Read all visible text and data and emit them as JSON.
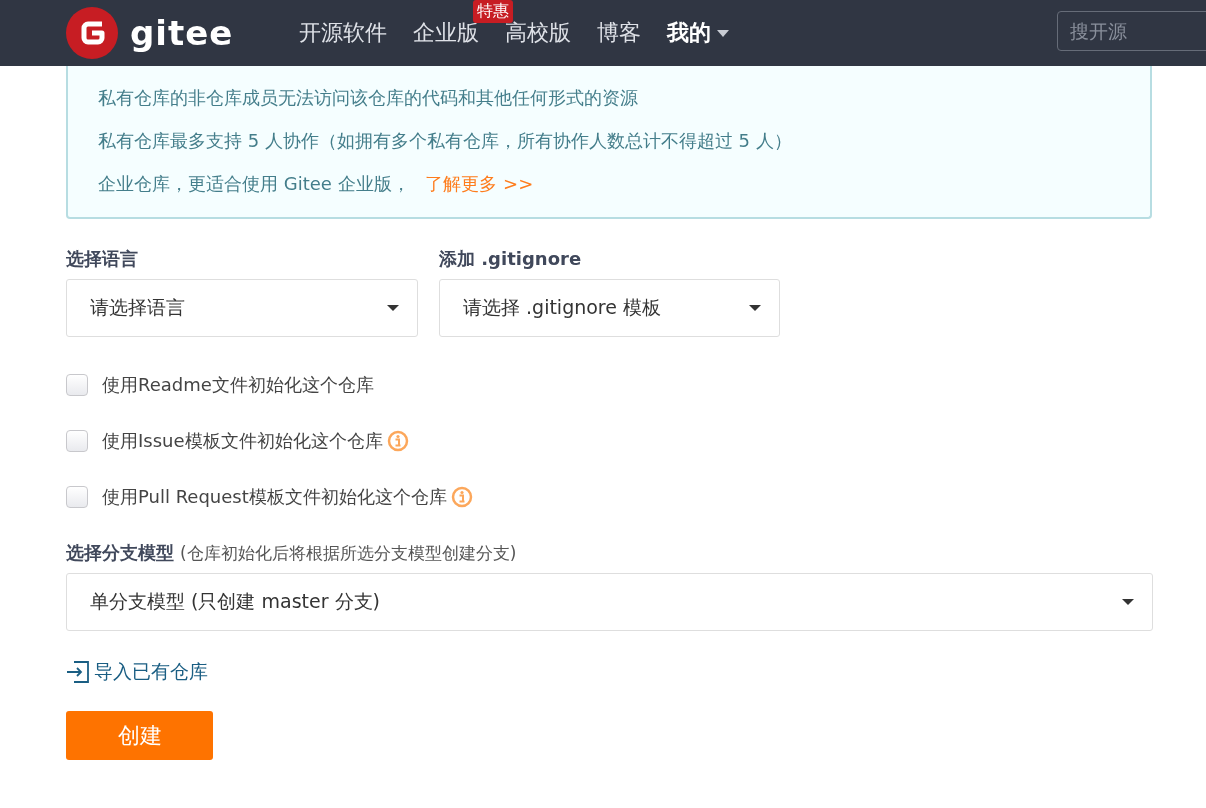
{
  "nav": {
    "logo_text": "gitee",
    "items": [
      {
        "label": "开源软件",
        "dropdown": false,
        "current": false
      },
      {
        "label": "企业版",
        "badge": "特惠",
        "dropdown": false,
        "current": false
      },
      {
        "label": "高校版",
        "dropdown": false,
        "current": false
      },
      {
        "label": "博客",
        "dropdown": false,
        "current": false
      },
      {
        "label": "我的",
        "dropdown": true,
        "current": true
      }
    ],
    "search": {
      "placeholder": "搜开源"
    }
  },
  "notice": {
    "lines": [
      "私有仓库的非仓库成员无法访问该仓库的代码和其他任何形式的资源",
      "私有仓库最多支持 5 人协作（如拥有多个私有仓库，所有协作人数总计不得超过 5 人）"
    ],
    "last_line": "企业仓库，更适合使用 Gitee 企业版，",
    "link": "了解更多 >>"
  },
  "selects": [
    {
      "label": "选择语言",
      "placeholder": "请选择语言"
    },
    {
      "label": "添加 .gitignore",
      "placeholder": "请选择 .gitignore 模板"
    }
  ],
  "checkboxes": [
    {
      "label": "使用Readme文件初始化这个仓库",
      "checked": false,
      "info": false
    },
    {
      "label": "使用Issue模板文件初始化这个仓库",
      "checked": false,
      "info": true
    },
    {
      "label": "使用Pull Request模板文件初始化这个仓库",
      "checked": false,
      "info": true
    }
  ],
  "branch": {
    "label": "选择分支模型",
    "hint": "(仓库初始化后将根据所选分支模型创建分支)",
    "value": "单分支模型 (只创建 master 分支)"
  },
  "import_link": "导入已有仓库",
  "create_button": "创建"
}
